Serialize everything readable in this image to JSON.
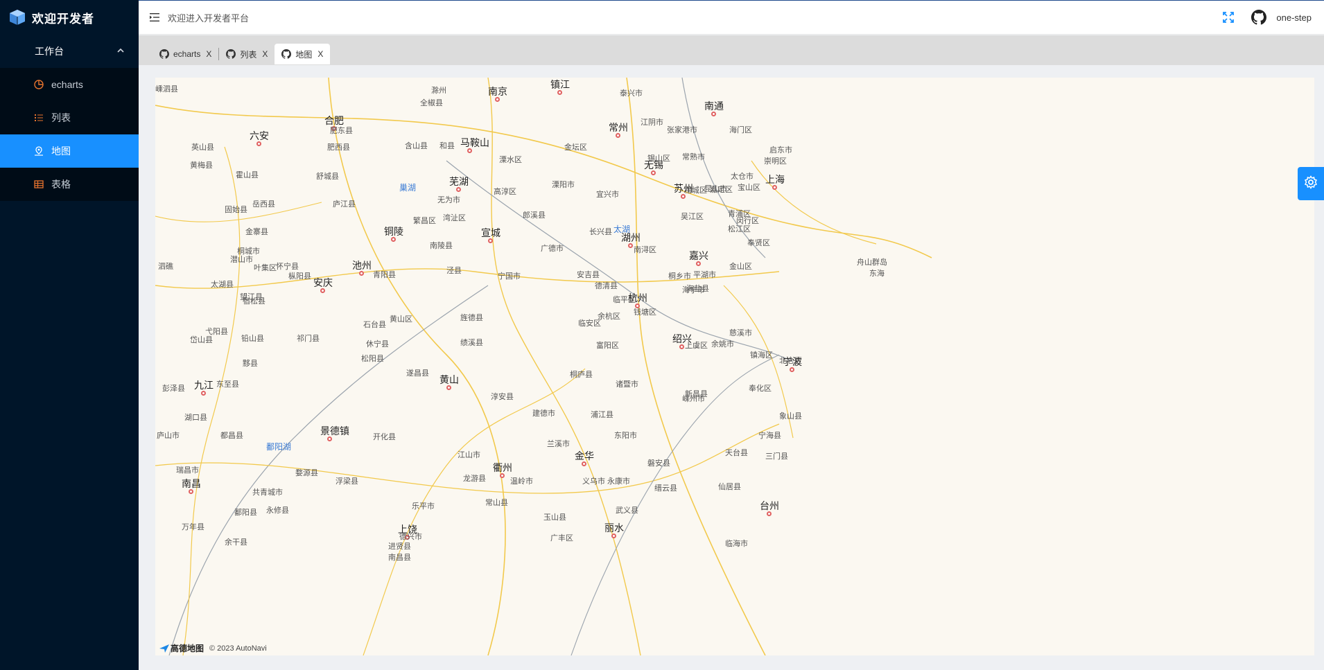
{
  "sidebar": {
    "brand": "欢迎开发者",
    "group_label": "工作台",
    "items": [
      {
        "label": "echarts",
        "icon": "pie-chart-icon"
      },
      {
        "label": "列表",
        "icon": "list-icon"
      },
      {
        "label": "地图",
        "icon": "map-pin-icon",
        "active": true
      },
      {
        "label": "表格",
        "icon": "table-icon"
      }
    ]
  },
  "topbar": {
    "welcome": "欢迎进入开发者平台",
    "username": "one-step"
  },
  "tabs": [
    {
      "label": "echarts",
      "close": "X"
    },
    {
      "label": "列表",
      "close": "X"
    },
    {
      "label": "地图",
      "close": "X",
      "active": true
    }
  ],
  "map": {
    "attribution_logo": "高德地图",
    "attribution_text": "© 2023 AutoNavi",
    "cities": [
      "南京",
      "合肥",
      "镇江",
      "常州",
      "南通",
      "上海",
      "苏州",
      "无锡",
      "马鞍山",
      "芜湖",
      "铜陵",
      "宣城",
      "湖州",
      "嘉兴",
      "池州",
      "安庆",
      "杭州",
      "绍兴",
      "宁波",
      "黄山",
      "九江",
      "景德镇",
      "金华",
      "衢州",
      "南昌",
      "台州",
      "丽水",
      "上饶",
      "六安"
    ],
    "labels": [
      "滁州",
      "全椒县",
      "泰兴市",
      "江阴市",
      "张家港市",
      "海门区",
      "启东市",
      "肥东县",
      "肥西县",
      "含山县",
      "和县",
      "溧水区",
      "金坛区",
      "锡山区",
      "常熟市",
      "崇明区",
      "太仓市",
      "嘉定区",
      "宝山区",
      "舒城县",
      "庐江县",
      "无为市",
      "高淳区",
      "溧阳市",
      "宜兴市",
      "相城区",
      "昆山市",
      "青浦区",
      "闵行区",
      "松江区",
      "繁昌区",
      "湾沚区",
      "郎溪县",
      "长兴县",
      "吴江区",
      "奉贤区",
      "南陵县",
      "广德市",
      "南浔区",
      "桐乡市",
      "平湖市",
      "金山区",
      "泾县",
      "宁国市",
      "安吉县",
      "德清县",
      "海宁市",
      "海盐县",
      "青阳县",
      "石台县",
      "黄山区",
      "旌德县",
      "绩溪县",
      "临安区",
      "余杭区",
      "临平区",
      "钱塘区",
      "富阳区",
      "上虞区",
      "余姚市",
      "慈溪市",
      "镇海区",
      "北仑区",
      "奉化区",
      "象山县",
      "宁海县",
      "三门县",
      "天台县",
      "嵊州市",
      "新昌县",
      "诸暨市",
      "桐庐县",
      "淳安县",
      "建德市",
      "浦江县",
      "兰溪市",
      "东阳市",
      "磐安县",
      "义乌市",
      "永康市",
      "武义县",
      "缙云县",
      "仙居县",
      "临海市",
      "温岭市",
      "龙游县",
      "常山县",
      "江山市",
      "开化县",
      "婺源县",
      "浮梁县",
      "乐平市",
      "德兴市",
      "玉山县",
      "广丰区",
      "遂昌县",
      "松阳县",
      "休宁县",
      "祁门县",
      "黟县",
      "东至县",
      "彭泽县",
      "湖口县",
      "都昌县",
      "庐山市",
      "瑞昌市",
      "共青城市",
      "永修县",
      "鄱阳县",
      "余干县",
      "万年县",
      "进贤县",
      "南昌县",
      "弋阳县",
      "铅山县",
      "宿松县",
      "望江县",
      "太湖县",
      "潜山市",
      "怀宁县",
      "枞阳县",
      "桐城市",
      "岳西县",
      "霍山县",
      "金寨县",
      "叶集区",
      "固始县",
      "英山县",
      "黄梅县",
      "嵊泗县",
      "泗礁",
      "岱山县",
      "舟山群岛",
      "东海"
    ],
    "lakes": [
      "巢湖",
      "太湖",
      "鄱阳湖"
    ]
  }
}
